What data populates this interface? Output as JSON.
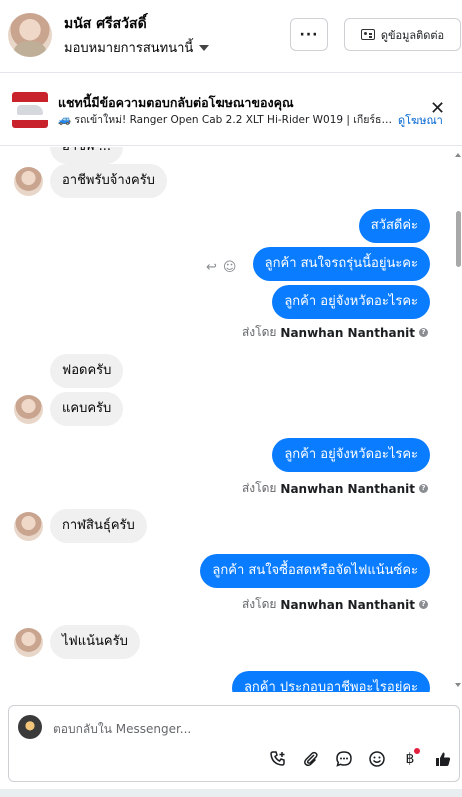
{
  "header": {
    "name": "มนัส ศรีสวัสดิ์",
    "assigned_to": "มอบหมายการสนทนานี้",
    "more_label": "···",
    "contact_label": "ดูข้อมูลติดต่อ"
  },
  "ad": {
    "title": "แชทนี้มีข้อความตอบกลับต่อโฆษณาของคุณ",
    "subtitle": "🚙 รถเข้าใหม่! Ranger Open Cab 2.2 XLT Hi-Rider W019 | เกียร์ธรรมดา ...",
    "link": "ดูโฆษณา",
    "close": "✕"
  },
  "messages": {
    "partial_top": "อาชีพ ...",
    "m1": "อาชีพรับจ้างครับ",
    "m2": "สวัสดีค่ะ",
    "m3": "ลูกค้า สนใจรถรุ่นนี้อยู่นะคะ",
    "m4": "ลูกค้า อยู่จังหวัดอะไรคะ",
    "m5": "ฟอดครับ",
    "m6": "แคบครับ",
    "m7": "ลูกค้า อยู่จังหวัดอะไรคะ",
    "m8": "กาฬสินธุ์ครับ",
    "m9": "ลูกค้า สนใจซื้อสดหรือจัดไฟแน้นซ์คะ",
    "m10": "ไฟแน้นครับ",
    "m11": "ลูกค้า ประกอบอาชีพอะไรอยู่คะ"
  },
  "sent_by": {
    "prefix": "ส่งโดย",
    "sender": "Nanwhan Nanthanit",
    "info": "?"
  },
  "composer": {
    "placeholder": "ตอบกลับใน Messenger..."
  },
  "colors": {
    "outgoing_bubble": "#0a7cff",
    "incoming_bubble": "#f0f0f0",
    "link": "#0064d1"
  },
  "icons": [
    "reply-icon",
    "emoji-icon",
    "call-add-icon",
    "attach-icon",
    "saved-reply-icon",
    "emoji-icon",
    "baht-icon",
    "thumbs-up-icon"
  ]
}
